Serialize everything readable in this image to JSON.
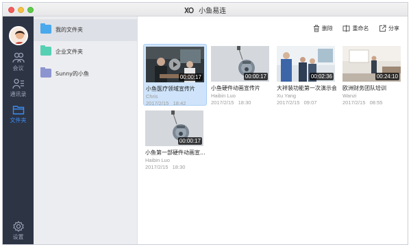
{
  "window": {
    "title": "小鱼易连"
  },
  "sidebar": {
    "items": [
      {
        "label": "会议",
        "icon": "people-icon"
      },
      {
        "label": "通讯录",
        "icon": "contacts-icon"
      },
      {
        "label": "文件夹",
        "icon": "folder-icon",
        "active": true
      },
      {
        "label": "设置",
        "icon": "gear-icon"
      }
    ]
  },
  "folders": [
    {
      "label": "我的文件夹",
      "color": "#4aa8ec",
      "active": true
    },
    {
      "label": "企业文件夹",
      "color": "#56d0b2"
    },
    {
      "label": "Sunny的小鱼",
      "color": "#8c95cf"
    }
  ],
  "toolbar": {
    "delete_label": "删除",
    "rename_label": "重命名",
    "share_label": "分享"
  },
  "videos": [
    {
      "title": "小鱼医疗领域宣传片",
      "author": "Chris",
      "date": "2017/2/15",
      "time": "18:42",
      "duration": "00:00:17",
      "selected": true
    },
    {
      "title": "小鱼硬件动画宣传片",
      "author": "Haibin Luo",
      "date": "2017/2/15",
      "time": "18:30",
      "duration": "00:00:17"
    },
    {
      "title": "大祥装功能第一次演示会",
      "author": "Xu Yang",
      "date": "2017/2/15",
      "time": "09:07",
      "duration": "00:02:36"
    },
    {
      "title": "欧洲财务团队培训",
      "author": "Wanzi",
      "date": "2017/2/15",
      "time": "08:55",
      "duration": "00:24:10"
    },
    {
      "title": "小鱼第一部硬件动画宣...",
      "author": "Haibin Luo",
      "date": "2017/2/15",
      "time": "18:30",
      "duration": "00:00:17"
    }
  ],
  "colors": {
    "sidebar_bg": "#2d3444",
    "accent": "#3b8df3",
    "selected_card": "#cfe4fa"
  }
}
